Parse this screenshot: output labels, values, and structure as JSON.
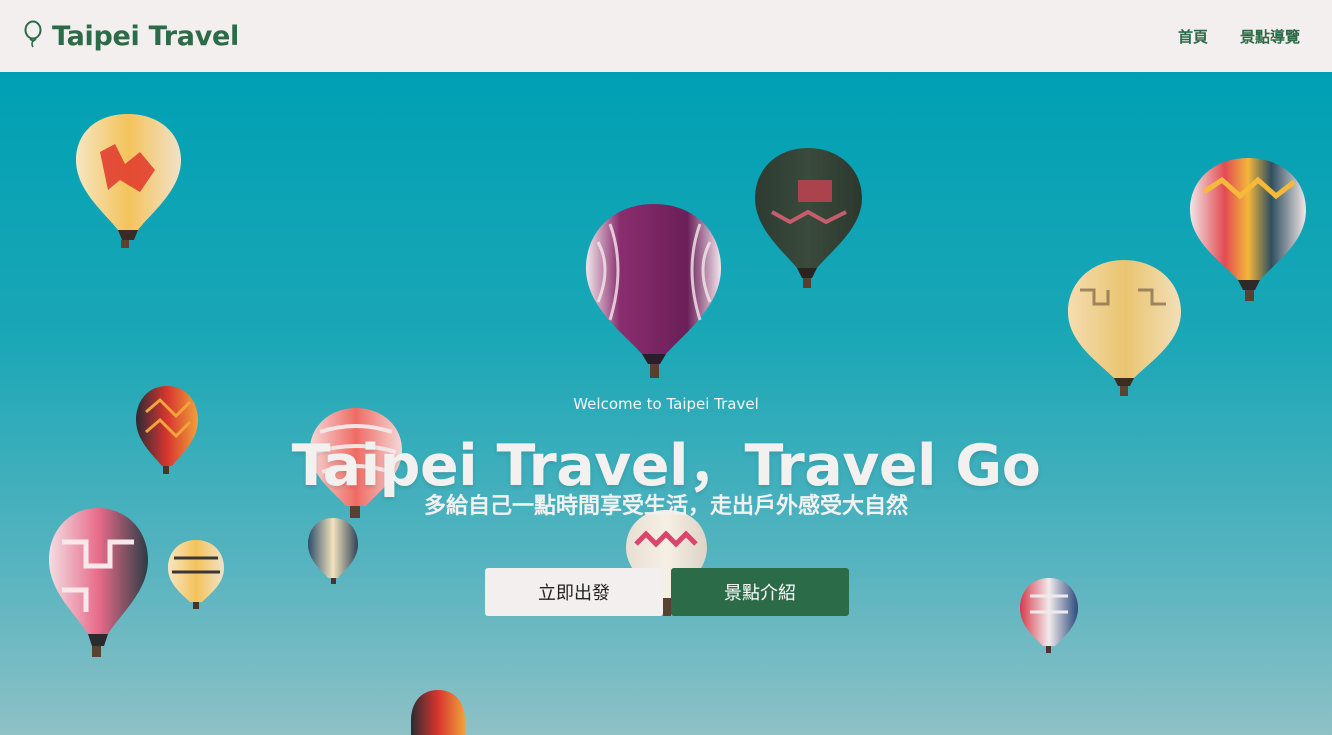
{
  "navbar": {
    "brand": "Taipei Travel",
    "brand_icon": "balloon-icon",
    "links": [
      "首頁",
      "景點導覽"
    ]
  },
  "hero": {
    "welcome": "Welcome to Taipei Travel",
    "title": "Taipei Travel，Travel Go",
    "subtitle": "多給自己一點時間享受生活，走出戶外感受大自然",
    "buttons": {
      "go": "立即出發",
      "intro": "景點介紹"
    },
    "background": "hot-air-balloons-sky"
  },
  "colors": {
    "brand_green": "#2c6b48",
    "nav_bg": "#f2efee",
    "sky_top": "#00a0b4",
    "sky_bottom": "#8ec1c6"
  }
}
